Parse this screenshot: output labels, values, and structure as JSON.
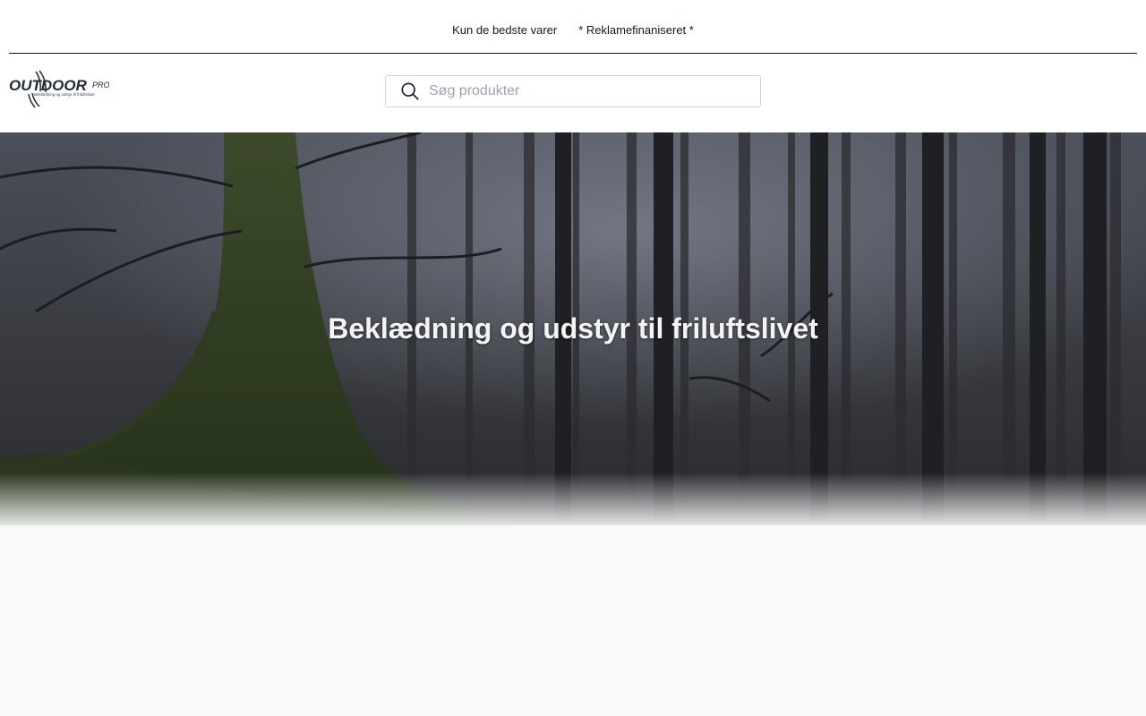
{
  "topbar": {
    "links": [
      "Kun de bedste varer",
      "* Reklamefinaniseret *"
    ]
  },
  "logo": {
    "word": "OUTDOOR",
    "suffix": "PRO",
    "tagline": "Beklædning og udstyr til friluftslivet"
  },
  "search": {
    "placeholder": "Søg produkter",
    "value": "",
    "icon": "search-icon"
  },
  "hero": {
    "title": "Beklædning og udstyr til friluftslivet"
  },
  "colors": {
    "text": "#111827",
    "background": "#f9fafb",
    "hero_text": "#f3f4f6"
  }
}
